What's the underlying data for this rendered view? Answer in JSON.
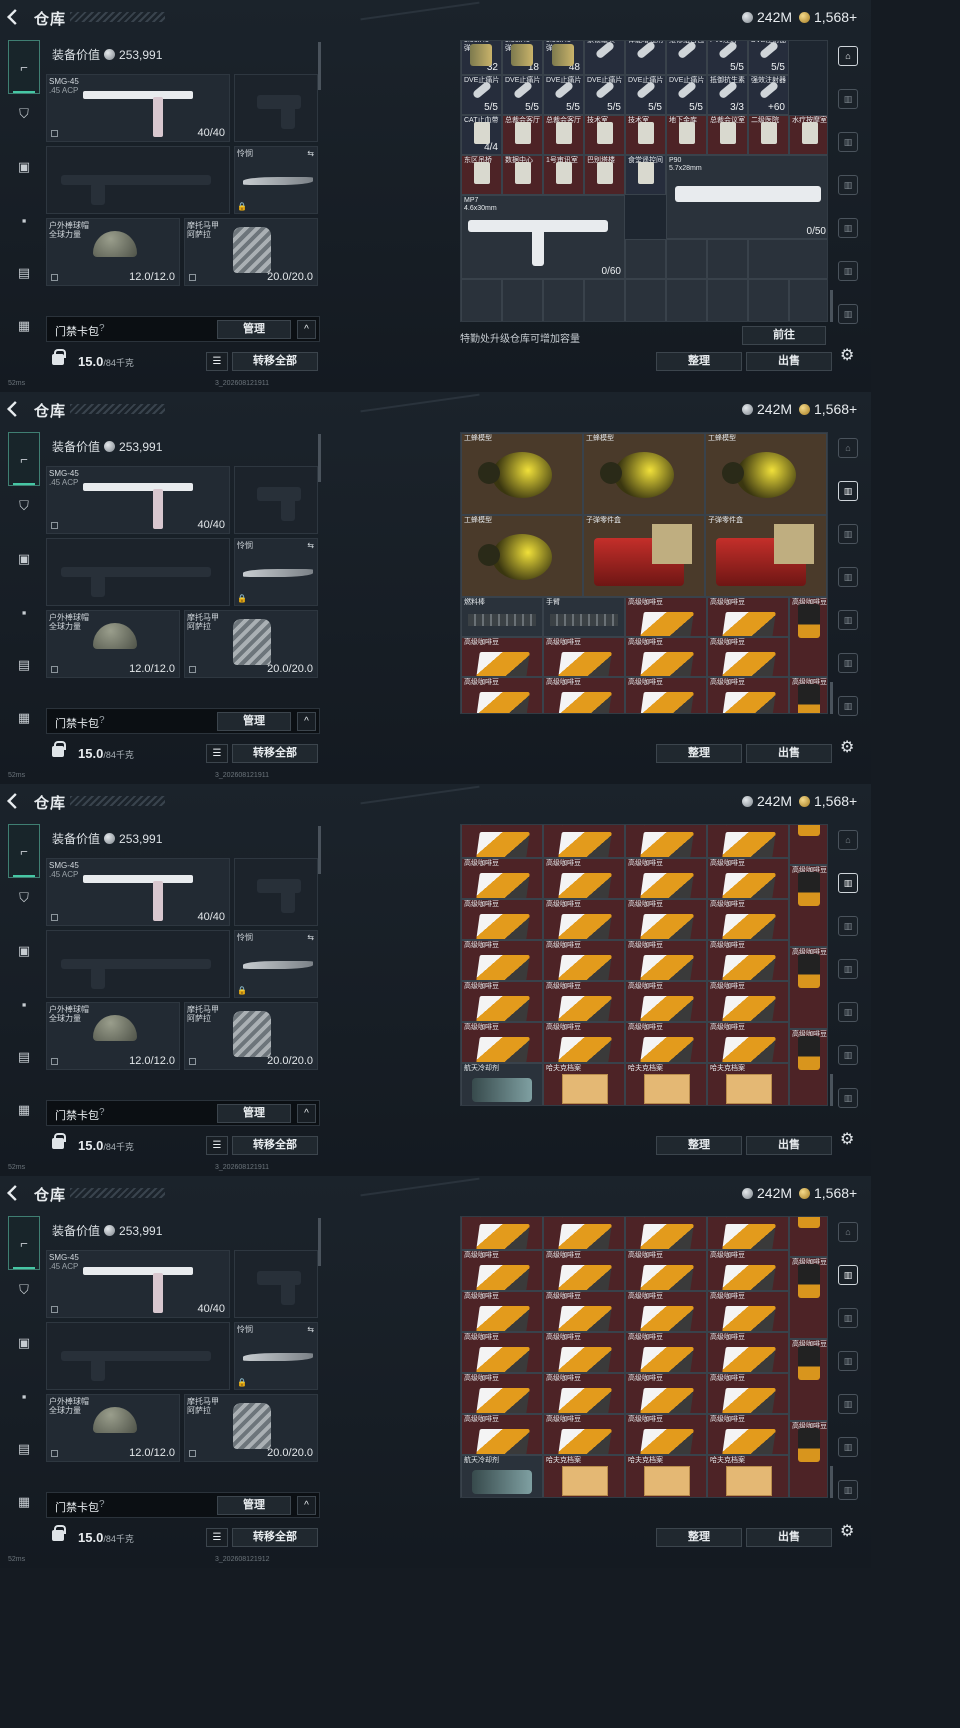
{
  "header": {
    "title": "仓库",
    "currency_silver": "242M",
    "currency_gold": "1,568+"
  },
  "loadout": {
    "equipment_value_label": "装备价值",
    "equipment_value": "253,991",
    "primary": {
      "name": "SMG-45",
      "ammo_type": ".45 ACP",
      "ammo": "40/40"
    },
    "melee": {
      "name": "怜悯"
    },
    "helmet": {
      "name": "户外棒球帽\n全球力量",
      "durability": "12.0/12.0"
    },
    "armor": {
      "name": "摩托马甲\n阿萨拉",
      "durability": "20.0/20.0"
    },
    "keycard_label": "门禁卡包",
    "help": "?",
    "manage_button": "管理",
    "up_button": "^",
    "weight": "15.0",
    "weight_unit": "/84千克",
    "transfer_all": "转移全部",
    "ping": "52ms",
    "builds": [
      "3_202608121911",
      "3_202608121911",
      "3_202608121911",
      "3_202608121912"
    ]
  },
  "stash": {
    "sort_button": "整理",
    "sell_button": "出售",
    "upgrade_hint": "特勤处升级仓库可增加容量",
    "goto_button": "前往",
    "p1_row1": [
      {
        "name": "5.56x45\n弹",
        "count": "32"
      },
      {
        "name": "5.56x45\n弹",
        "count": "18"
      },
      {
        "name": "5.56x45\n弹",
        "count": "48"
      },
      {
        "name": "家馈罐头",
        "count": ""
      },
      {
        "name": "体能增强剂",
        "count": ""
      },
      {
        "name": "维修组合包",
        "count": ""
      },
      {
        "name": "PVJ注射",
        "count": "5/5"
      },
      {
        "name": "DVE注射器",
        "count": "5/5"
      }
    ],
    "p1_row2": [
      {
        "name": "DVE止痛片",
        "count": "5/5"
      },
      {
        "name": "DVE止痛片",
        "count": "5/5"
      },
      {
        "name": "DVE止痛片",
        "count": "5/5"
      },
      {
        "name": "DVE止痛片",
        "count": "5/5"
      },
      {
        "name": "DVE止痛片",
        "count": "5/5"
      },
      {
        "name": "DVE止痛片",
        "count": "5/5"
      },
      {
        "name": "抵御抗生素",
        "count": "3/3"
      },
      {
        "name": "强效注射器",
        "count": "+60"
      }
    ],
    "p1_row3": [
      {
        "name": "CAT止血带",
        "count": "4/4"
      },
      {
        "name": "总裁会客厅",
        "count": ""
      },
      {
        "name": "总裁会客厅",
        "count": ""
      },
      {
        "name": "技术室",
        "count": ""
      },
      {
        "name": "技术室",
        "count": ""
      },
      {
        "name": "地下金库",
        "count": ""
      },
      {
        "name": "总裁会议室",
        "count": ""
      },
      {
        "name": "二级医院",
        "count": ""
      },
      {
        "name": "水疗按摩室",
        "count": ""
      }
    ],
    "p1_row4": [
      {
        "name": "东区吊桥",
        "count": ""
      },
      {
        "name": "数据中心",
        "count": ""
      },
      {
        "name": "1号审讯室",
        "count": ""
      },
      {
        "name": "巴别塔楼",
        "count": ""
      },
      {
        "name": "食堂遥控间",
        "count": ""
      }
    ],
    "p90": {
      "name": "P90",
      "caliber": "5.7x28mm",
      "ammo": "0/50"
    },
    "mp7": {
      "name": "MP7",
      "caliber": "4.6x30mm",
      "ammo": "0/60"
    },
    "wasp_label": "工蜂模型",
    "ammo_box_label": "子弹零件盒",
    "rod_label": "燃料棒",
    "grip_label": "手臂",
    "coffee_label": "高级咖啡豆",
    "cooler_label": "航天冷却剂",
    "file_label": "哈夫克档案"
  },
  "icons": {
    "back": "chevron-left-icon",
    "silver": "silver-coin-icon",
    "gold": "gold-coin-icon",
    "gear": "gear-icon"
  }
}
